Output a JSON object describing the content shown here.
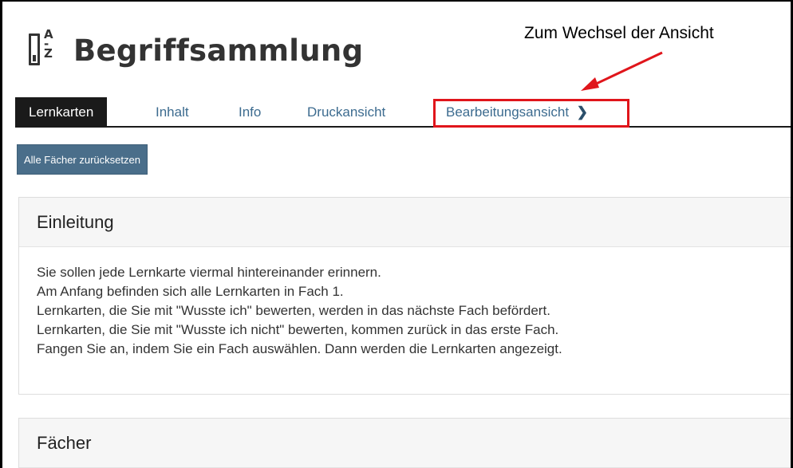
{
  "header": {
    "icon": "glossary-az-icon",
    "icon_letters": [
      "A",
      "-",
      "Z"
    ],
    "title": "Begriffsammlung"
  },
  "annotation": {
    "text": "Zum Wechsel der Ansicht",
    "color": "#e0151b"
  },
  "tabs": [
    {
      "label": "Lernkarten",
      "active": true
    },
    {
      "label": "Inhalt",
      "active": false
    },
    {
      "label": "Info",
      "active": false
    },
    {
      "label": "Druckansicht",
      "active": false
    },
    {
      "label": "Bearbeitungsansicht",
      "active": false,
      "icon": "chevron-right-icon",
      "highlighted": true
    }
  ],
  "reset_button": {
    "label": "Alle Fächer zurücksetzen"
  },
  "intro_panel": {
    "title": "Einleitung",
    "lines": [
      "Sie sollen jede Lernkarte viermal hintereinander erinnern.",
      "Am Anfang befinden sich alle Lernkarten in Fach 1.",
      "Lernkarten, die Sie mit \"Wusste ich\" bewerten, werden in das nächste Fach befördert.",
      "Lernkarten, die Sie mit \"Wusste ich nicht\" bewerten, kommen zurück in das erste Fach.",
      "Fangen Sie an, indem Sie ein Fach auswählen. Dann werden die Lernkarten angezeigt."
    ]
  },
  "subjects_panel": {
    "title": "Fächer"
  },
  "colors": {
    "active_tab_bg": "#1a1a1a",
    "tab_link": "#3c6b8f",
    "button_bg": "#4a6e8a",
    "highlight": "#e0151b"
  }
}
